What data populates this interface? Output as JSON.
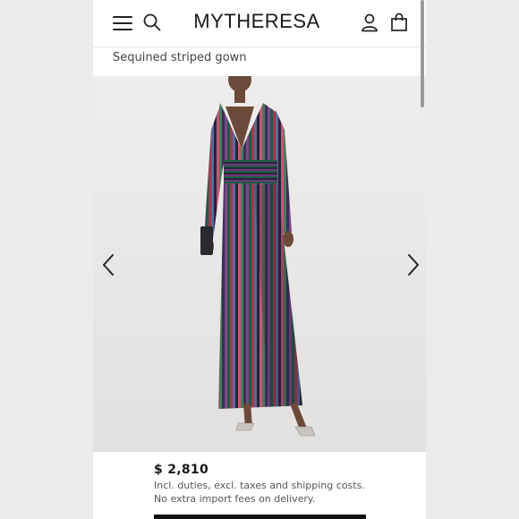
{
  "header": {
    "logo": "MYTHERESA",
    "icons": {
      "menu": "hamburger-menu-icon",
      "search": "search-icon",
      "account": "user-icon",
      "bag": "shopping-bag-icon"
    }
  },
  "product": {
    "title": "Sequined striped gown",
    "price": "$ 2,810",
    "price_note_1": "Incl. duties, excl. taxes and shipping costs.",
    "price_note_2": "No extra import fees on delivery."
  },
  "gallery": {
    "prev_icon": "chevron-left-icon",
    "next_icon": "chevron-right-icon"
  },
  "colors": {
    "accent": "#111111",
    "gown_stripes": [
      "#3a2f5a",
      "#7a4a86",
      "#1f5a48",
      "#a03a4a",
      "#5a6a9a",
      "#2a2438",
      "#c05878",
      "#4a7a5a"
    ]
  }
}
